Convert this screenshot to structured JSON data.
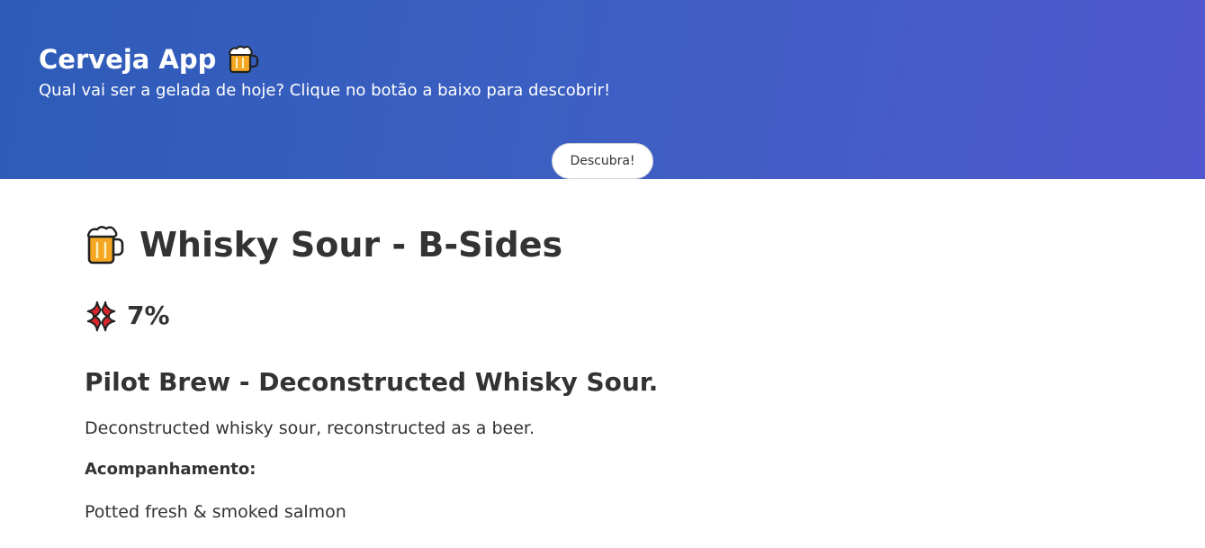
{
  "header": {
    "title": "Cerveja App",
    "title_icon": "beer-mug-icon",
    "subtitle": "Qual vai ser a gelada de hoje? Clique no botão a baixo para descobrir!",
    "discover_button": "Descubra!",
    "gradient_start": "#2e5bb8",
    "gradient_end": "#5158cf"
  },
  "beer": {
    "name_icon": "beer-mug-icon",
    "name": "Whisky Sour - B-Sides",
    "abv_icon": "anger-symbol-icon",
    "abv": "7%",
    "tagline": "Pilot Brew - Deconstructed Whisky Sour.",
    "description": "Deconstructed whisky sour, reconstructed as a beer.",
    "pairing_label": "Acompanhamento:",
    "food_pairing": [
      "Potted fresh & smoked salmon"
    ]
  }
}
